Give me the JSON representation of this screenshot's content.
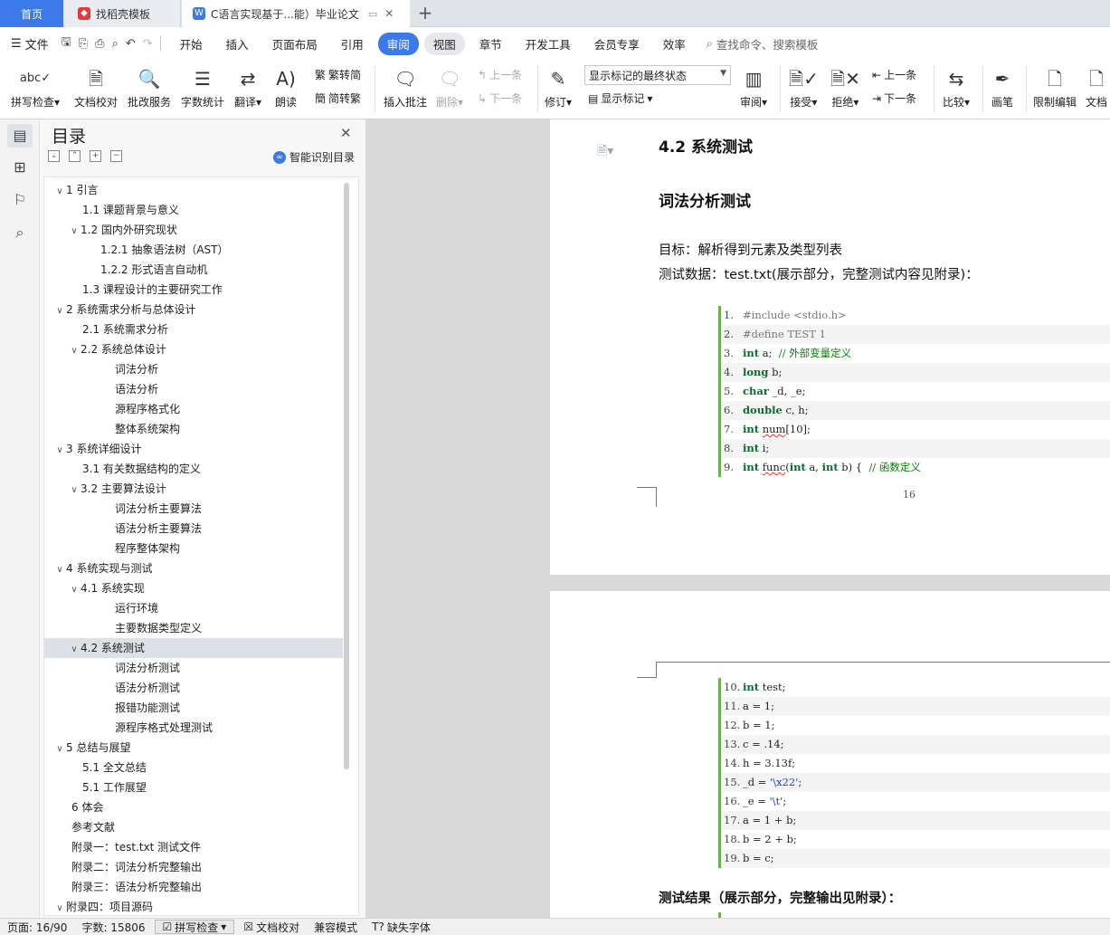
{
  "tabs": {
    "home": "首页",
    "template": "找稻壳模板",
    "doc": "C语言实现基于...能）毕业论文"
  },
  "menubar": {
    "file": "文件",
    "tabs": [
      "开始",
      "插入",
      "页面布局",
      "引用",
      "审阅",
      "视图",
      "章节",
      "开发工具",
      "会员专享",
      "效率"
    ],
    "active_tab": "审阅",
    "search": "查找命令、搜索模板"
  },
  "ribbon": {
    "spellcheck": "拼写检查",
    "doc_check": "文档校对",
    "review_service": "批改服务",
    "word_count": "字数统计",
    "translate": "翻译",
    "read_aloud": "朗读",
    "to_traditional": "繁转简",
    "to_simplified": "简转繁",
    "insert_comment": "插入批注",
    "delete": "删除",
    "prev_comment": "上一条",
    "next_comment": "下一条",
    "track_changes": "修订",
    "markup_state": "显示标记的最终状态",
    "show_markup": "显示标记",
    "review": "审阅",
    "accept": "接受",
    "reject": "拒绝",
    "prev": "上一条",
    "next": "下一条",
    "compare": "比较",
    "pen": "画笔",
    "restrict_edit": "限制编辑",
    "doc_more": "文档"
  },
  "nav": {
    "title": "目录",
    "smart": "智能识别目录",
    "items": [
      {
        "text": "1 引言",
        "level": 0,
        "caret": "open"
      },
      {
        "text": "1.1 课题背景与意义",
        "level": 1,
        "caret": "none"
      },
      {
        "text": "1.2 国内外研究现状",
        "level": 1,
        "caret": "open"
      },
      {
        "text": "1.2.1  抽象语法树（AST）",
        "level": 2,
        "caret": "none"
      },
      {
        "text": "1.2.2  形式语言自动机",
        "level": 2,
        "caret": "none"
      },
      {
        "text": "1.3 课程设计的主要研究工作",
        "level": 1,
        "caret": "none"
      },
      {
        "text": "2 系统需求分析与总体设计",
        "level": 0,
        "caret": "open"
      },
      {
        "text": "2.1 系统需求分析",
        "level": 1,
        "caret": "none"
      },
      {
        "text": "2.2 系统总体设计",
        "level": 1,
        "caret": "open"
      },
      {
        "text": "词法分析",
        "level": 3,
        "caret": "none"
      },
      {
        "text": "语法分析",
        "level": 3,
        "caret": "none"
      },
      {
        "text": "源程序格式化",
        "level": 3,
        "caret": "none"
      },
      {
        "text": "整体系统架构",
        "level": 3,
        "caret": "none"
      },
      {
        "text": "3 系统详细设计",
        "level": 0,
        "caret": "open"
      },
      {
        "text": "3.1 有关数据结构的定义",
        "level": 1,
        "caret": "none"
      },
      {
        "text": "3.2  主要算法设计",
        "level": 1,
        "caret": "open"
      },
      {
        "text": "词法分析主要算法",
        "level": 3,
        "caret": "none"
      },
      {
        "text": "语法分析主要算法",
        "level": 3,
        "caret": "none"
      },
      {
        "text": "程序整体架构",
        "level": 3,
        "caret": "none"
      },
      {
        "text": "4 系统实现与测试",
        "level": 0,
        "caret": "open"
      },
      {
        "text": "4.1 系统实现",
        "level": 1,
        "caret": "open"
      },
      {
        "text": "运行环境",
        "level": 3,
        "caret": "none"
      },
      {
        "text": "主要数据类型定义",
        "level": 3,
        "caret": "none"
      },
      {
        "text": "4.2 系统测试",
        "level": 1,
        "caret": "open",
        "selected": true
      },
      {
        "text": "词法分析测试",
        "level": 3,
        "caret": "none"
      },
      {
        "text": "语法分析测试",
        "level": 3,
        "caret": "none"
      },
      {
        "text": "报错功能测试",
        "level": 3,
        "caret": "none"
      },
      {
        "text": "源程序格式处理测试",
        "level": 3,
        "caret": "none"
      },
      {
        "text": "5 总结与展望",
        "level": 0,
        "caret": "open"
      },
      {
        "text": "5.1 全文总结",
        "level": 1,
        "caret": "none"
      },
      {
        "text": "5.1 工作展望",
        "level": 1,
        "caret": "none"
      },
      {
        "text": "6   体会",
        "level": 0,
        "caret": "none"
      },
      {
        "text": "参考文献",
        "level": 0,
        "caret": "none"
      },
      {
        "text": "附录一：test.txt 测试文件",
        "level": 0,
        "caret": "none"
      },
      {
        "text": "附录二：词法分析完整输出",
        "level": 0,
        "caret": "none"
      },
      {
        "text": "附录三：语法分析完整输出",
        "level": 0,
        "caret": "none"
      },
      {
        "text": "附录四：项目源码",
        "level": 0,
        "caret": "open"
      }
    ]
  },
  "document": {
    "section_title": "4.2 系统测试",
    "subsection_title": "词法分析测试",
    "goal": "目标：解析得到元素及类型列表",
    "test_data": "测试数据：test.txt(展示部分，完整测试内容见附录)：",
    "page_number": "16",
    "result": "测试结果（展示部分，完整输出见附录）：",
    "code_page1": [
      {
        "n": "1.",
        "parts": [
          {
            "t": "#include <stdio.h>",
            "c": "pp"
          }
        ]
      },
      {
        "n": "2.",
        "parts": [
          {
            "t": "#define TEST 1",
            "c": "pp"
          }
        ]
      },
      {
        "n": "3.",
        "parts": [
          {
            "t": "int",
            "c": "kw"
          },
          {
            "t": " a;  ",
            "c": ""
          },
          {
            "t": "// 外部变量定义",
            "c": "cm"
          }
        ]
      },
      {
        "n": "4.",
        "parts": [
          {
            "t": "long",
            "c": "kw"
          },
          {
            "t": " b;",
            "c": ""
          }
        ]
      },
      {
        "n": "5.",
        "parts": [
          {
            "t": "char",
            "c": "kw"
          },
          {
            "t": " _d, _e;",
            "c": ""
          }
        ]
      },
      {
        "n": "6.",
        "parts": [
          {
            "t": "double",
            "c": "kw"
          },
          {
            "t": " c, h;",
            "c": ""
          }
        ]
      },
      {
        "n": "7.",
        "parts": [
          {
            "t": "int",
            "c": "kw"
          },
          {
            "t": " ",
            "c": ""
          },
          {
            "t": "num",
            "c": "sq"
          },
          {
            "t": "[10];",
            "c": ""
          }
        ]
      },
      {
        "n": "8.",
        "parts": [
          {
            "t": "int",
            "c": "kw"
          },
          {
            "t": " i;",
            "c": ""
          }
        ]
      },
      {
        "n": "9.",
        "parts": [
          {
            "t": "int",
            "c": "kw"
          },
          {
            "t": " ",
            "c": ""
          },
          {
            "t": "func",
            "c": "sq"
          },
          {
            "t": "(",
            "c": ""
          },
          {
            "t": "int",
            "c": "kw"
          },
          {
            "t": " a, ",
            "c": ""
          },
          {
            "t": "int",
            "c": "kw"
          },
          {
            "t": " b) {  ",
            "c": ""
          },
          {
            "t": "// 函数定义",
            "c": "cm"
          }
        ]
      }
    ],
    "code_page2": [
      {
        "n": "10.",
        "parts": [
          {
            "t": "int",
            "c": "kw"
          },
          {
            "t": " test;",
            "c": ""
          }
        ]
      },
      {
        "n": "11.",
        "parts": [
          {
            "t": "a = 1;",
            "c": ""
          }
        ]
      },
      {
        "n": "12.",
        "parts": [
          {
            "t": "b = 1;",
            "c": ""
          }
        ]
      },
      {
        "n": "13.",
        "parts": [
          {
            "t": "c = .14;",
            "c": ""
          }
        ]
      },
      {
        "n": "14.",
        "parts": [
          {
            "t": "h = 3.13f;",
            "c": ""
          }
        ]
      },
      {
        "n": "15.",
        "parts": [
          {
            "t": "_d = ",
            "c": ""
          },
          {
            "t": "'\\x22'",
            "c": "str"
          },
          {
            "t": ";",
            "c": ""
          }
        ]
      },
      {
        "n": "16.",
        "parts": [
          {
            "t": "_e = ",
            "c": ""
          },
          {
            "t": "'\\t'",
            "c": "str"
          },
          {
            "t": ";",
            "c": ""
          }
        ]
      },
      {
        "n": "17.",
        "parts": [
          {
            "t": "a = 1 + b;",
            "c": ""
          }
        ]
      },
      {
        "n": "18.",
        "parts": [
          {
            "t": "b = 2 + b;",
            "c": ""
          }
        ]
      },
      {
        "n": "19.",
        "parts": [
          {
            "t": "b = c;",
            "c": ""
          }
        ]
      }
    ]
  },
  "status": {
    "page": "页面: 16/90",
    "words": "字数: 15806",
    "spellcheck": "拼写检查",
    "doc_check": "文档校对",
    "compat": "兼容模式",
    "missing_fonts": "缺失字体"
  },
  "colors": {
    "accent": "#3b7ae8",
    "code_bar": "#6ab04c",
    "keyword": "#0b6b2e",
    "comment": "#0a7a0a"
  }
}
